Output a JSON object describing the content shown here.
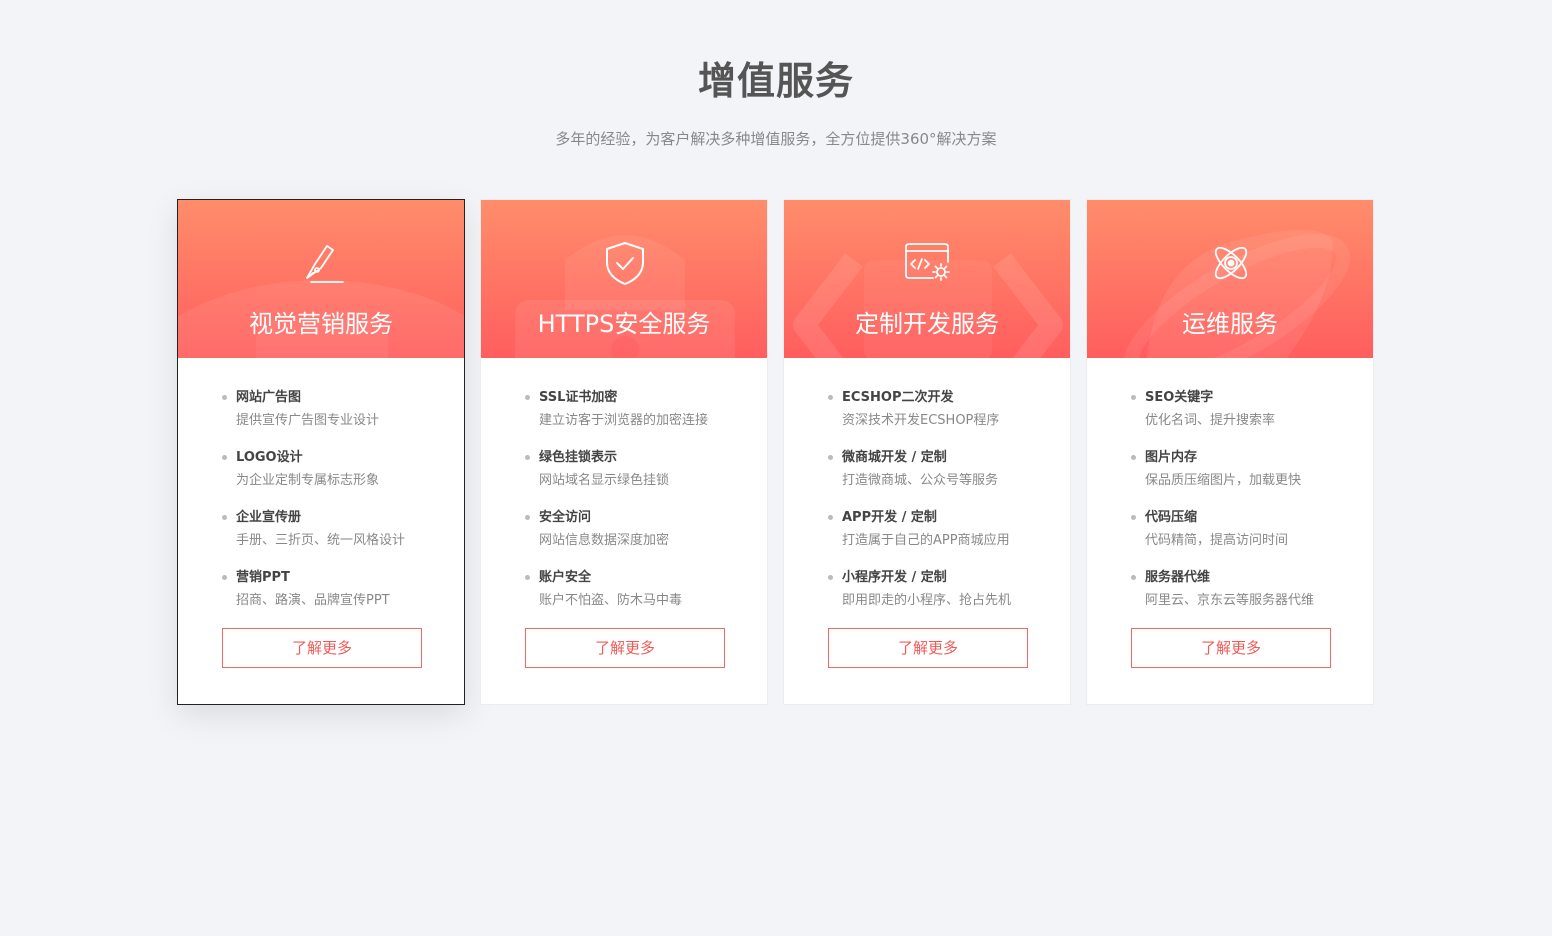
{
  "header": {
    "title": "增值服务",
    "subtitle": "多年的经验，为客户解决多种增值服务，全方位提供360°解决方案"
  },
  "colors": {
    "gradient_top": "#ff8d6b",
    "gradient_bottom": "#ff5e5e",
    "accent": "#ef5c58"
  },
  "cards": [
    {
      "title": "视觉营销服务",
      "icon": "pen-icon",
      "features": [
        {
          "title": "网站广告图",
          "desc": "提供宣传广告图专业设计"
        },
        {
          "title": "LOGO设计",
          "desc": "为企业定制专属标志形象"
        },
        {
          "title": "企业宣传册",
          "desc": "手册、三折页、统一风格设计"
        },
        {
          "title": "营销PPT",
          "desc": "招商、路演、品牌宣传PPT"
        }
      ],
      "button": "了解更多"
    },
    {
      "title": "HTTPS安全服务",
      "icon": "shield-check-icon",
      "features": [
        {
          "title": "SSL证书加密",
          "desc": "建立访客于浏览器的加密连接"
        },
        {
          "title": "绿色挂锁表示",
          "desc": "网站域名显示绿色挂锁"
        },
        {
          "title": "安全访问",
          "desc": "网站信息数据深度加密"
        },
        {
          "title": "账户安全",
          "desc": "账户不怕盗、防木马中毒"
        }
      ],
      "button": "了解更多"
    },
    {
      "title": "定制开发服务",
      "icon": "code-gear-icon",
      "features": [
        {
          "title": "ECSHOP二次开发",
          "desc": "资深技术开发ECSHOP程序"
        },
        {
          "title": "微商城开发 / 定制",
          "desc": "打造微商城、公众号等服务"
        },
        {
          "title": "APP开发 / 定制",
          "desc": "打造属于自己的APP商城应用"
        },
        {
          "title": "小程序开发 / 定制",
          "desc": "即用即走的小程序、抢占先机"
        }
      ],
      "button": "了解更多"
    },
    {
      "title": "运维服务",
      "icon": "atom-icon",
      "features": [
        {
          "title": "SEO关键字",
          "desc": "优化名词、提升搜索率"
        },
        {
          "title": "图片内存",
          "desc": "保品质压缩图片，加载更快"
        },
        {
          "title": "代码压缩",
          "desc": "代码精简，提高访问时间"
        },
        {
          "title": "服务器代维",
          "desc": "阿里云、京东云等服务器代维"
        }
      ],
      "button": "了解更多"
    }
  ]
}
